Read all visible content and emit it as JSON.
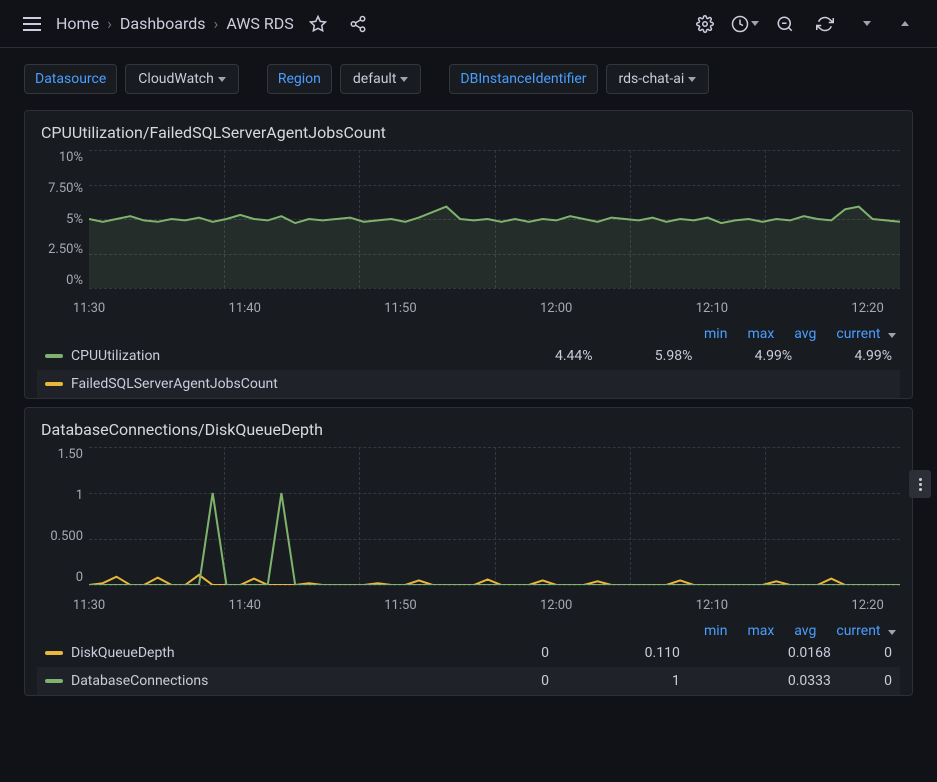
{
  "breadcrumb": {
    "home": "Home",
    "dashboards": "Dashboards",
    "current": "AWS RDS"
  },
  "vars": {
    "ds_label": "Datasource",
    "ds_value": "CloudWatch",
    "region_label": "Region",
    "region_value": "default",
    "dbid_label": "DBInstanceIdentifier",
    "dbid_value": "rds-chat-ai"
  },
  "panel1": {
    "title": "CPUUtilization/FailedSQLServerAgentJobsCount",
    "yticks": [
      "10%",
      "7.50%",
      "5%",
      "2.50%",
      "0%"
    ],
    "xticks": [
      "11:30",
      "11:40",
      "11:50",
      "12:00",
      "12:10",
      "12:20"
    ],
    "legend_headers": {
      "min": "min",
      "max": "max",
      "avg": "avg",
      "current": "current"
    },
    "series": [
      {
        "name": "CPUUtilization",
        "color": "#7EB26D",
        "min": "4.44%",
        "max": "5.98%",
        "avg": "4.99%",
        "current": "4.99%"
      },
      {
        "name": "FailedSQLServerAgentJobsCount",
        "color": "#EAB839",
        "min": "",
        "max": "",
        "avg": "",
        "current": ""
      }
    ]
  },
  "panel2": {
    "title": "DatabaseConnections/DiskQueueDepth",
    "yticks": [
      "1.50",
      "1",
      "0.500",
      "0"
    ],
    "xticks": [
      "11:30",
      "11:40",
      "11:50",
      "12:00",
      "12:10",
      "12:20"
    ],
    "legend_headers": {
      "min": "min",
      "max": "max",
      "avg": "avg",
      "current": "current"
    },
    "series": [
      {
        "name": "DiskQueueDepth",
        "color": "#EAB839",
        "min": "0",
        "max": "0.110",
        "avg": "0.0168",
        "current": "0"
      },
      {
        "name": "DatabaseConnections",
        "color": "#7EB26D",
        "min": "0",
        "max": "1",
        "avg": "0.0333",
        "current": "0"
      }
    ]
  },
  "chart_data": [
    {
      "type": "line",
      "title": "CPUUtilization/FailedSQLServerAgentJobsCount",
      "xlabel": "",
      "ylabel": "",
      "x_range_minutes": [
        "11:30",
        "12:28"
      ],
      "ylim": [
        0,
        10
      ],
      "y_unit": "%",
      "series": [
        {
          "name": "CPUUtilization",
          "color": "#7EB26D",
          "values": [
            5.0,
            4.8,
            5.0,
            5.2,
            4.9,
            4.8,
            5.0,
            4.9,
            5.1,
            4.8,
            5.0,
            5.3,
            5.0,
            4.9,
            5.2,
            4.7,
            5.0,
            4.9,
            5.0,
            5.1,
            4.8,
            4.9,
            5.0,
            4.8,
            5.1,
            5.5,
            5.9,
            5.0,
            4.9,
            5.0,
            4.8,
            5.0,
            4.8,
            5.0,
            4.9,
            5.2,
            5.0,
            4.8,
            5.1,
            5.0,
            4.9,
            5.1,
            4.8,
            5.0,
            4.9,
            5.1,
            4.7,
            4.9,
            5.0,
            4.8,
            5.0,
            4.9,
            5.2,
            5.0,
            4.9,
            5.7,
            5.9,
            5.0,
            4.9,
            4.8
          ]
        },
        {
          "name": "FailedSQLServerAgentJobsCount",
          "values": []
        }
      ]
    },
    {
      "type": "line",
      "title": "DatabaseConnections/DiskQueueDepth",
      "xlabel": "",
      "ylabel": "",
      "x_range_minutes": [
        "11:30",
        "12:28"
      ],
      "ylim": [
        0,
        1.5
      ],
      "series": [
        {
          "name": "DiskQueueDepth",
          "color": "#EAB839",
          "values": [
            0,
            0.02,
            0.09,
            0,
            0,
            0.08,
            0,
            0,
            0.11,
            0,
            0,
            0,
            0.07,
            0,
            0,
            0,
            0.02,
            0,
            0,
            0,
            0,
            0.02,
            0,
            0,
            0.05,
            0,
            0,
            0,
            0,
            0.06,
            0,
            0,
            0,
            0.05,
            0,
            0,
            0,
            0.04,
            0,
            0,
            0,
            0,
            0,
            0.05,
            0,
            0,
            0,
            0,
            0,
            0,
            0.04,
            0,
            0,
            0,
            0.07,
            0,
            0,
            0,
            0,
            0
          ]
        },
        {
          "name": "DatabaseConnections",
          "color": "#7EB26D",
          "values": [
            0,
            0,
            0,
            0,
            0,
            0,
            0,
            0,
            0,
            1,
            0,
            0,
            0,
            0,
            1,
            0,
            0,
            0,
            0,
            0,
            0,
            0,
            0,
            0,
            0,
            0,
            0,
            0,
            0,
            0,
            0,
            0,
            0,
            0,
            0,
            0,
            0,
            0,
            0,
            0,
            0,
            0,
            0,
            0,
            0,
            0,
            0,
            0,
            0,
            0,
            0,
            0,
            0,
            0,
            0,
            0,
            0,
            0,
            0,
            0
          ]
        }
      ]
    }
  ]
}
